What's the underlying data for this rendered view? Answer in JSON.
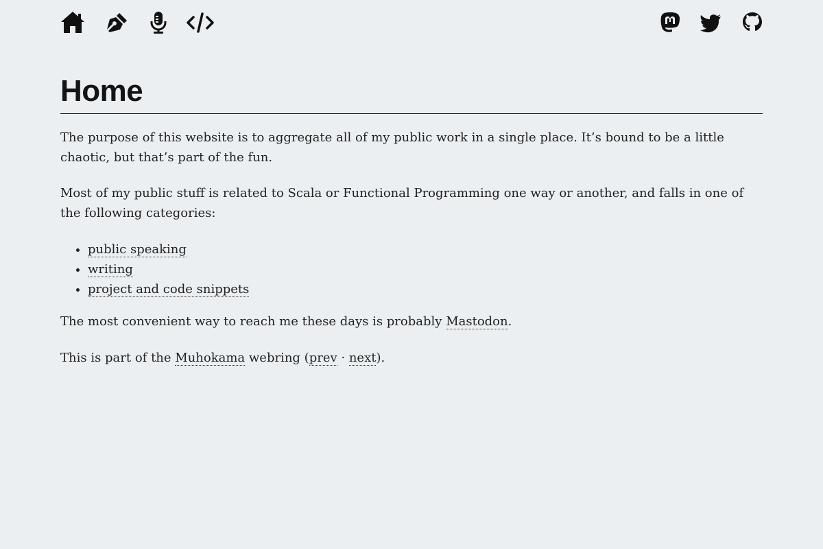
{
  "nav": {
    "left_icons": [
      "home-icon",
      "pen-icon",
      "microphone-icon",
      "code-icon"
    ],
    "right_icons": [
      "mastodon-icon",
      "twitter-icon",
      "github-icon"
    ]
  },
  "page_title": "Home",
  "intro": "The purpose of this website is to aggregate all of my public work in a single place. It’s bound to be a little chaotic, but that’s part of the fun.",
  "categories_intro": "Most of my public stuff is related to Scala or Functional Programming one way or another, and falls in one of the following categories:",
  "categories": [
    {
      "label": "public speaking"
    },
    {
      "label": "writing"
    },
    {
      "label": "project and code snippets"
    }
  ],
  "contact": {
    "before": "The most convenient way to reach me these days is probably ",
    "link": "Mastodon",
    "after": "."
  },
  "webring": {
    "before": "This is part of the ",
    "ring_link": "Muhokama",
    "middle": " webring (",
    "prev": "prev",
    "separator": " · ",
    "next": "next",
    "after": ")."
  }
}
